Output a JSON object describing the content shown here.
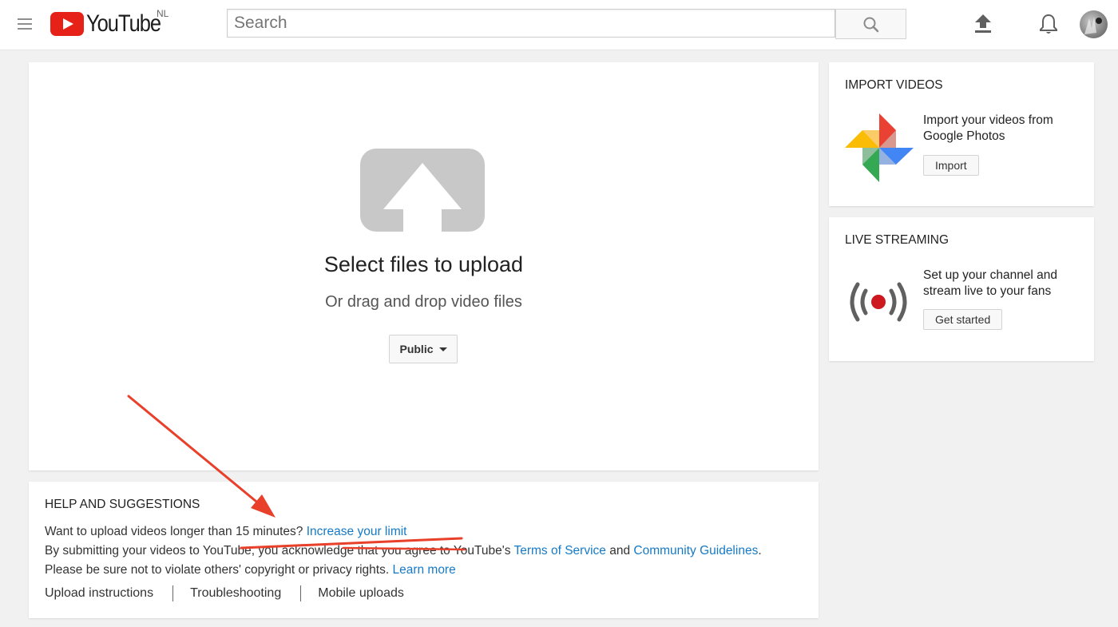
{
  "header": {
    "logo_text": "YouTube",
    "logo_country": "NL",
    "search_placeholder": "Search"
  },
  "upload": {
    "title": "Select files to upload",
    "subtitle": "Or drag and drop video files",
    "privacy_label": "Public"
  },
  "help": {
    "title": "HELP AND SUGGESTIONS",
    "line1_text": "Want to upload videos longer than 15 minutes? ",
    "line1_link": "Increase your limit",
    "line2_text": "By submitting your videos to YouTube, you acknowledge that you agree to YouTube's ",
    "line2_link1": "Terms of Service",
    "line2_and": " and ",
    "line2_link2": "Community Guidelines",
    "line2_end": ".",
    "line3_text": "Please be sure not to violate others' copyright or privacy rights. ",
    "line3_link": "Learn more",
    "links": [
      "Upload instructions",
      "Troubleshooting",
      "Mobile uploads"
    ]
  },
  "import_videos": {
    "title": "IMPORT VIDEOS",
    "text": "Import your videos from Google Photos",
    "button": "Import"
  },
  "live_streaming": {
    "title": "LIVE STREAMING",
    "text": "Set up your channel and stream live to your fans",
    "button": "Get started"
  },
  "colors": {
    "brand_red": "#e62117",
    "link_blue": "#167ac6",
    "annotation_red": "#e8402a"
  }
}
